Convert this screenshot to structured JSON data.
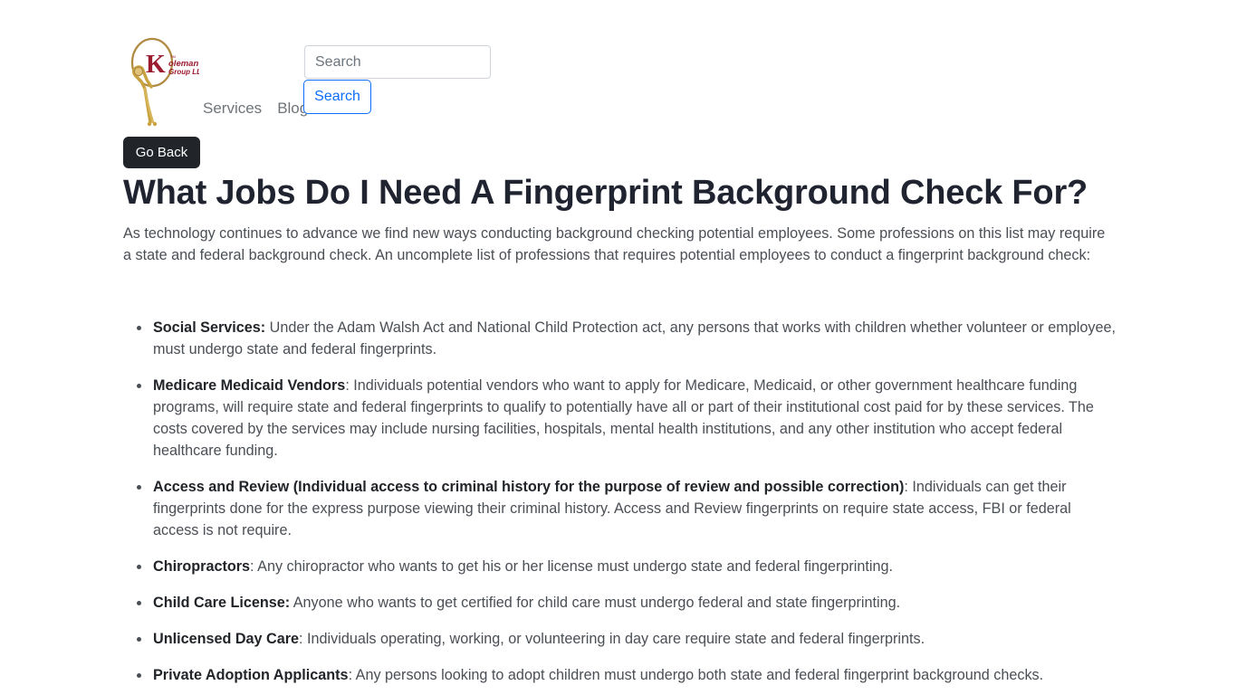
{
  "header": {
    "logo": {
      "letter": "K",
      "wordmark_line1": "oleman",
      "wordmark_line2": "Group LLC",
      "tm": "TM",
      "colors": {
        "letter": "#9b1b30",
        "wordmark": "#9b1b30",
        "oval": "#b08a42",
        "figure": "#c9a33f"
      }
    },
    "nav": [
      {
        "label": "Services"
      },
      {
        "label": "Blog"
      }
    ],
    "search": {
      "placeholder": "Search",
      "value": "",
      "button_label": "Search",
      "button_color": "#0d6efd"
    }
  },
  "main": {
    "go_back_label": "Go Back",
    "title": "What Jobs Do I Need A Fingerprint Background Check For?",
    "intro": "As technology continues to advance we find new ways conducting background checking potential employees. Some professions on this list may require a state and federal background check. An uncomplete list of professions that requires potential employees to conduct a fingerprint background check:",
    "items": [
      {
        "term": "Social Services:",
        "text": " Under the Adam Walsh Act and National Child Protection act, any persons that works with children whether volunteer or employee, must undergo state and federal fingerprints."
      },
      {
        "term": "Medicare Medicaid Vendors",
        "text": ": Individuals potential vendors who want to apply for Medicare, Medicaid, or other government healthcare funding programs, will require state and federal fingerprints to qualify to potentially have all or part of their institutional cost paid for by these services. The costs covered by the services may include nursing facilities, hospitals, mental health institutions, and any other institution who accept federal healthcare funding."
      },
      {
        "term": "Access and Review (Individual access to criminal history for the purpose of review and possible correction)",
        "text": ": Individuals can get their fingerprints done for the express purpose viewing their criminal history. Access and Review fingerprints on require state access, FBI or federal access is not require."
      },
      {
        "term": "Chiropractors",
        "text": ": Any chiropractor who wants to get his or her license must undergo state and federal fingerprinting."
      },
      {
        "term": "Child Care License:",
        "text": " Anyone who wants to get certified for child care must undergo federal and state fingerprinting."
      },
      {
        "term": "Unlicensed Day Care",
        "text": ": Individuals operating, working, or volunteering in day care require state and federal fingerprints."
      },
      {
        "term": "Private Adoption Applicants",
        "text": ": Any persons looking to adopt children must undergo both state and federal fingerprint background checks."
      }
    ]
  }
}
